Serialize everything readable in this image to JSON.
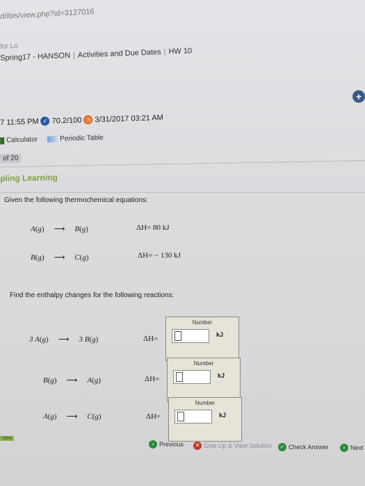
{
  "browser": {
    "url": "d/ibis/view.php?id=3127016",
    "for_text": "for Lo"
  },
  "breadcrumbs": {
    "course": "Spring17 - HANSON",
    "activities": "Activities and Due Dates",
    "assignment": "HW 10"
  },
  "status": {
    "time": "7 11:55 PM",
    "score": "70.2/100",
    "due": "3/31/2017 03:21 AM"
  },
  "tools": {
    "calculator": "Calculator",
    "periodic_table": "Periodic Table"
  },
  "question_counter": "of 20",
  "brand": "pling Learning",
  "question": {
    "given_prompt": "Given the following thermochemical equations:",
    "given": [
      {
        "reactant": "A",
        "reactant_state": "g",
        "product": "B",
        "product_state": "g",
        "dh": "ΔH= 80  kJ"
      },
      {
        "reactant": "B",
        "reactant_state": "g",
        "product": "C",
        "product_state": "g",
        "dh": "ΔH= − 130  kJ"
      }
    ],
    "find_prompt": "Find the enthalpy changes for the following reactions:",
    "reactions": [
      {
        "left": "3 A",
        "left_state": "g",
        "right": "3 B",
        "right_state": "g",
        "dh_label": "ΔH=",
        "box_label": "Number",
        "value": "",
        "unit": "kJ"
      },
      {
        "left": "B",
        "left_state": "g",
        "right": "A",
        "right_state": "g",
        "dh_label": "ΔH=",
        "box_label": "Number",
        "value": "",
        "unit": "kJ"
      },
      {
        "left": "A",
        "left_state": "g",
        "right": "C",
        "right_state": "g",
        "dh_label": "ΔH=",
        "box_label": "Number",
        "value": "",
        "unit": "kJ"
      }
    ]
  },
  "footer": {
    "hint": "Hint",
    "previous": "Previous",
    "give_up": "Give Up & View Solution",
    "check": "Check Answer",
    "next": "Next"
  }
}
